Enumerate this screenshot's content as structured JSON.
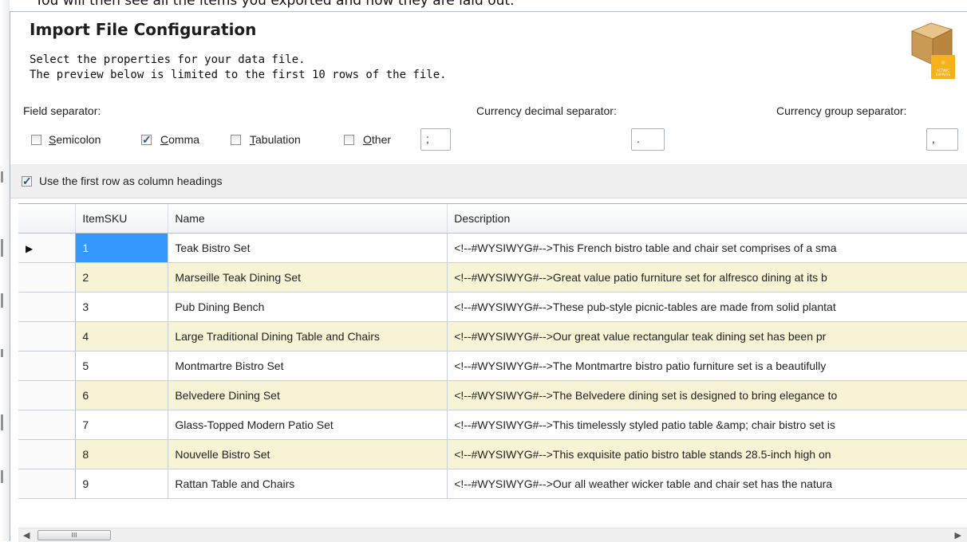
{
  "top_caption": "You will then see all the items you exported and how they are laid out.",
  "dialog": {
    "title": "Import File Configuration",
    "subtitle_line1": "Select the properties for your data file.",
    "subtitle_line2": "The preview below is limited to the first 10 rows of the file.",
    "logo_icon": "actinic-express-box-icon",
    "logo_text_line1": "ACTINIC",
    "logo_text_line2": "EXPRESS"
  },
  "separator": {
    "label": "Field separator:",
    "options": [
      {
        "prefix": "",
        "accel": "S",
        "rest": "emicolon",
        "checked": false
      },
      {
        "prefix": "",
        "accel": "C",
        "rest": "omma",
        "checked": true
      },
      {
        "prefix": "",
        "accel": "T",
        "rest": "abulation",
        "checked": false
      },
      {
        "prefix": "",
        "accel": "O",
        "rest": "ther",
        "checked": false
      }
    ],
    "other_value": ";"
  },
  "currency": {
    "decimal_label": "Currency decimal separator:",
    "decimal_value": ".",
    "group_label": "Currency group separator:",
    "group_value": ","
  },
  "headings_option": {
    "label": "Use the first row as column headings",
    "checked": true
  },
  "grid": {
    "columns": [
      "ItemSKU",
      "Name",
      "Description"
    ],
    "rows": [
      [
        "1",
        "Teak Bistro Set",
        "<!--#WYSIWYG#-->This French bistro table and chair set comprises of a sma"
      ],
      [
        "2",
        "Marseille Teak Dining Set",
        "<!--#WYSIWYG#-->Great value patio furniture set for alfresco dining at its b"
      ],
      [
        "3",
        "Pub Dining Bench",
        "<!--#WYSIWYG#-->These pub-style picnic-tables are made from solid plantat"
      ],
      [
        "4",
        "Large Traditional Dining Table and Chairs",
        "<!--#WYSIWYG#-->Our great value rectangular teak dining  set has been pr"
      ],
      [
        "5",
        "Montmartre Bistro Set",
        "<!--#WYSIWYG#-->The Montmartre bistro patio furniture set is a beautifully"
      ],
      [
        "6",
        "Belvedere Dining Set",
        "<!--#WYSIWYG#-->The Belvedere dining set is designed to bring elegance to"
      ],
      [
        "7",
        "Glass-Topped Modern Patio Set",
        "<!--#WYSIWYG#-->This timelessly styled patio table &amp; chair bistro set is"
      ],
      [
        "8",
        "Nouvelle Bistro Set",
        "<!--#WYSIWYG#-->This exquisite patio bistro table stands 28.5-inch high on"
      ],
      [
        "9",
        "Rattan Table and Chairs",
        "<!--#WYSIWYG#-->Our all weather wicker table and chair set has the natura"
      ]
    ],
    "current_row_indicator": "▶",
    "alternate_row_color": "#f7f4d5",
    "selected_cell_color": "#3399ff"
  },
  "scrollbar": {
    "left_arrow": "◀",
    "thumb_grip": "III",
    "right_arrow": "▶"
  }
}
